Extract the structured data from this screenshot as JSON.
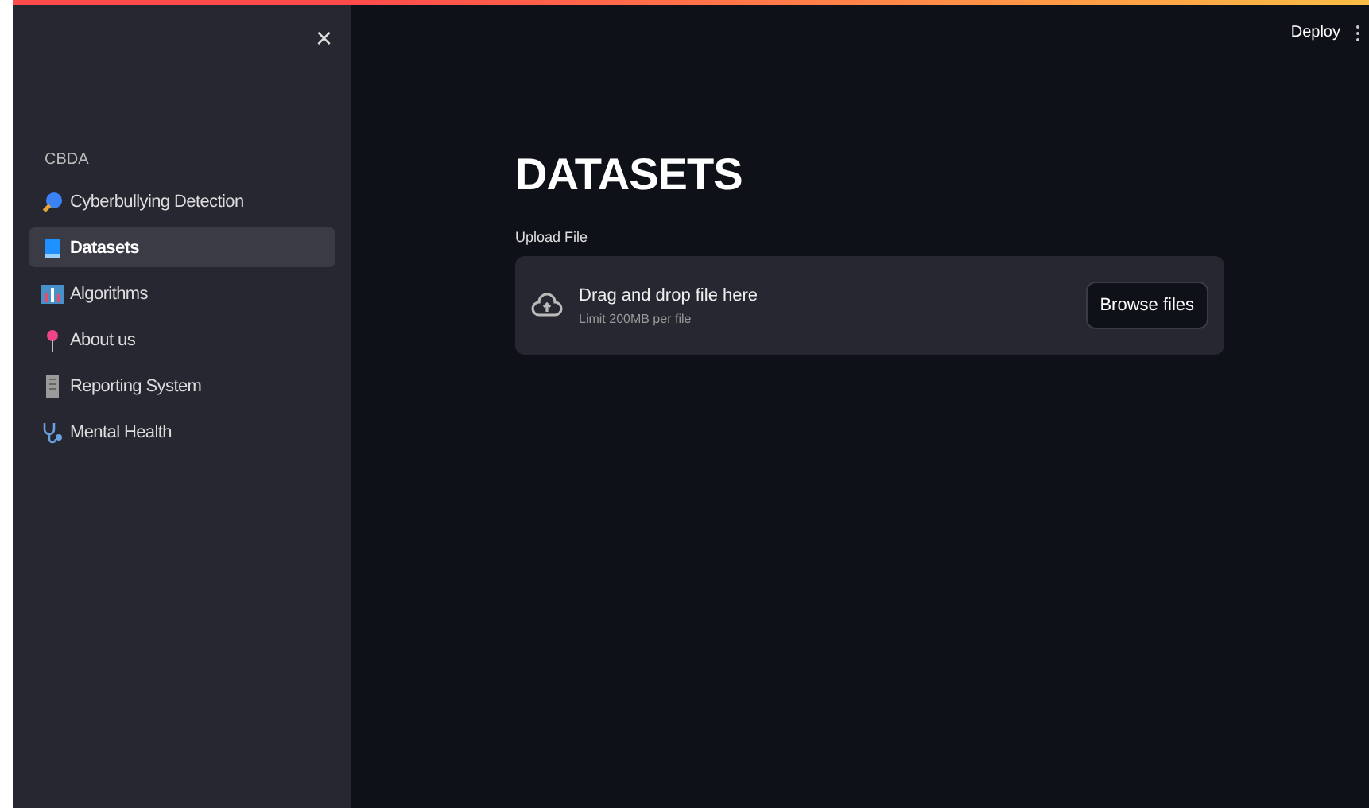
{
  "sidebar": {
    "close": "×",
    "section_title": "CBDA",
    "items": [
      {
        "label": "Cyberbullying Detection",
        "selected": false
      },
      {
        "label": "Datasets",
        "selected": true
      },
      {
        "label": "Algorithms",
        "selected": false
      },
      {
        "label": "About us",
        "selected": false
      },
      {
        "label": "Reporting System",
        "selected": false
      },
      {
        "label": "Mental Health",
        "selected": false
      }
    ]
  },
  "header": {
    "deploy": "Deploy"
  },
  "main": {
    "title": "DATASETS",
    "uploader": {
      "label": "Upload File",
      "prompt": "Drag and drop file here",
      "limit": "Limit 200MB per file",
      "button": "Browse files"
    }
  }
}
